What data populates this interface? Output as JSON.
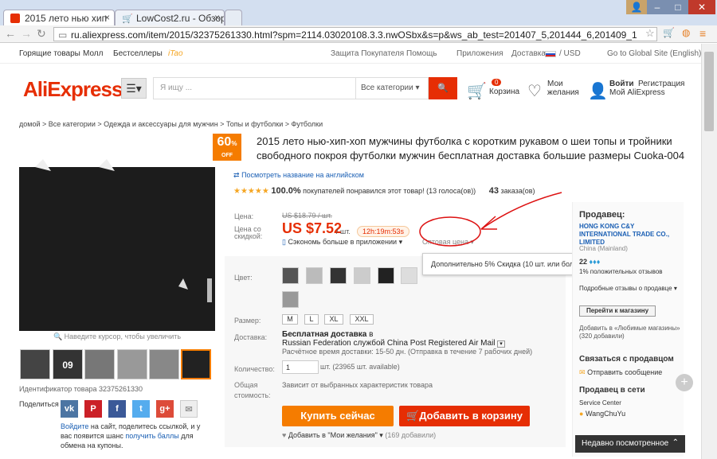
{
  "browser": {
    "tabs": [
      {
        "label": "2015 лето нью хип",
        "active": true
      },
      {
        "label": "LowCost2.ru - Обзор",
        "active": false
      }
    ],
    "url": "ru.aliexpress.com/item/2015/32375261330.html?spm=2114.03020108.3.3.nwOSbx&s=p&ws_ab_test=201407_5,201444_6,201409_1"
  },
  "topnav": {
    "left": [
      "Горящие товары",
      "Молл",
      "Бестселлеры",
      "iTao"
    ],
    "right": [
      "Защита Покупателя",
      "Помощь",
      "Приложения",
      "Доставка в",
      "/ USD",
      "Go to Global Site (English)"
    ]
  },
  "header": {
    "logo": "AliExpress",
    "search_placeholder": "Я ищу ...",
    "category": "Все категории",
    "cart_count": "0",
    "cart_label": "Корзина",
    "wish_label1": "Мои",
    "wish_label2": "желания",
    "login": "Войти",
    "register": "Регистрация",
    "my": "Мой AliExpress"
  },
  "breadcrumb": "домой > Все категории > Одежда и аксессуары для мужчин > Топы и футболки > Футболки",
  "gallery": {
    "discount": "60",
    "discount_pct": "%",
    "discount_off": "OFF",
    "hover_hint": "Наведите курсор, чтобы увеличить",
    "product_id": "Идентификатор товара 32375261330",
    "share_label": "Поделиться",
    "login_text": "Войдите",
    "share_text": " на сайт, поделитесь ссылкой, и у вас появится шанс ",
    "points_text": "получить баллы",
    "share_tail": " для обмена на купоны."
  },
  "product": {
    "title": "2015 лето нью-хип-хоп мужчины футболка с коротким рукавом о шеи топы и тройники свободного покроя футболки мужчин бесплатная доставка большие размеры Cuoka-004",
    "translate": "Посмотреть название на английском",
    "rating_pct": "100.0%",
    "rating_text": "покупателей понравился этот товар! (13 голоса(ов))",
    "orders": "43",
    "orders_label": "заказа(ов)"
  },
  "price": {
    "label": "Цена:",
    "old": "US $18.79 / шт.",
    "discount_label1": "Цена со",
    "discount_label2": "скидкой:",
    "new": "US $7.52",
    "unit": "/ шт.",
    "timer": "12h:19m:53s",
    "app_save": "Сэкономь больше в приложении",
    "wholesale": "Оптовая цена"
  },
  "tooltip": "Дополнительно 5% Скидка (10 шт. или больше)",
  "options": {
    "color_label": "Цвет:",
    "size_label": "Размер:",
    "sizes": [
      "M",
      "L",
      "XL",
      "XXL"
    ],
    "shipping_label": "Доставка:",
    "shipping_title": "Бесплатная доставка",
    "shipping_to": " в",
    "shipping_line": "Russian Federation службой China Post Registered Air Mail",
    "shipping_time": "Расчётное время доставки: 15-50 дн. (Отправка в течение 7 рабочих дней)",
    "qty_label": "Количество:",
    "qty_value": "1",
    "qty_avail": "шт. (23965 шт. available)",
    "total_label1": "Общая",
    "total_label2": "стоимость:",
    "total_text": "Зависит от выбранных характеристик товара",
    "buy": "Купить сейчас",
    "add_cart": "Добавить в корзину",
    "wishlist": "Добавить в \"Мои желания\"",
    "wish_count": "(169 добавили)"
  },
  "seller": {
    "title": "Продавец:",
    "name": "HONG KONG C&Y INTERNATIONAL TRADE CO., LIMITED",
    "country": "China (Mainland)",
    "score": "22",
    "positive": "1% положительных отзывов",
    "details": "Подробные отзывы о продавце",
    "go_store": "Перейти к магазину",
    "fav": "Добавить в «Любимые магазины» (320 добавили)",
    "contact_title": "Связаться с продавцом",
    "message": "Отправить сообщение",
    "online_title": "Продавец в сети",
    "service": "Service Center",
    "agent": "WangChuYu",
    "recent": "Недавно посмотренное"
  },
  "colors": {
    "accent": "#e62e04",
    "orange": "#f57c00",
    "blue": "#1a5fb4"
  }
}
